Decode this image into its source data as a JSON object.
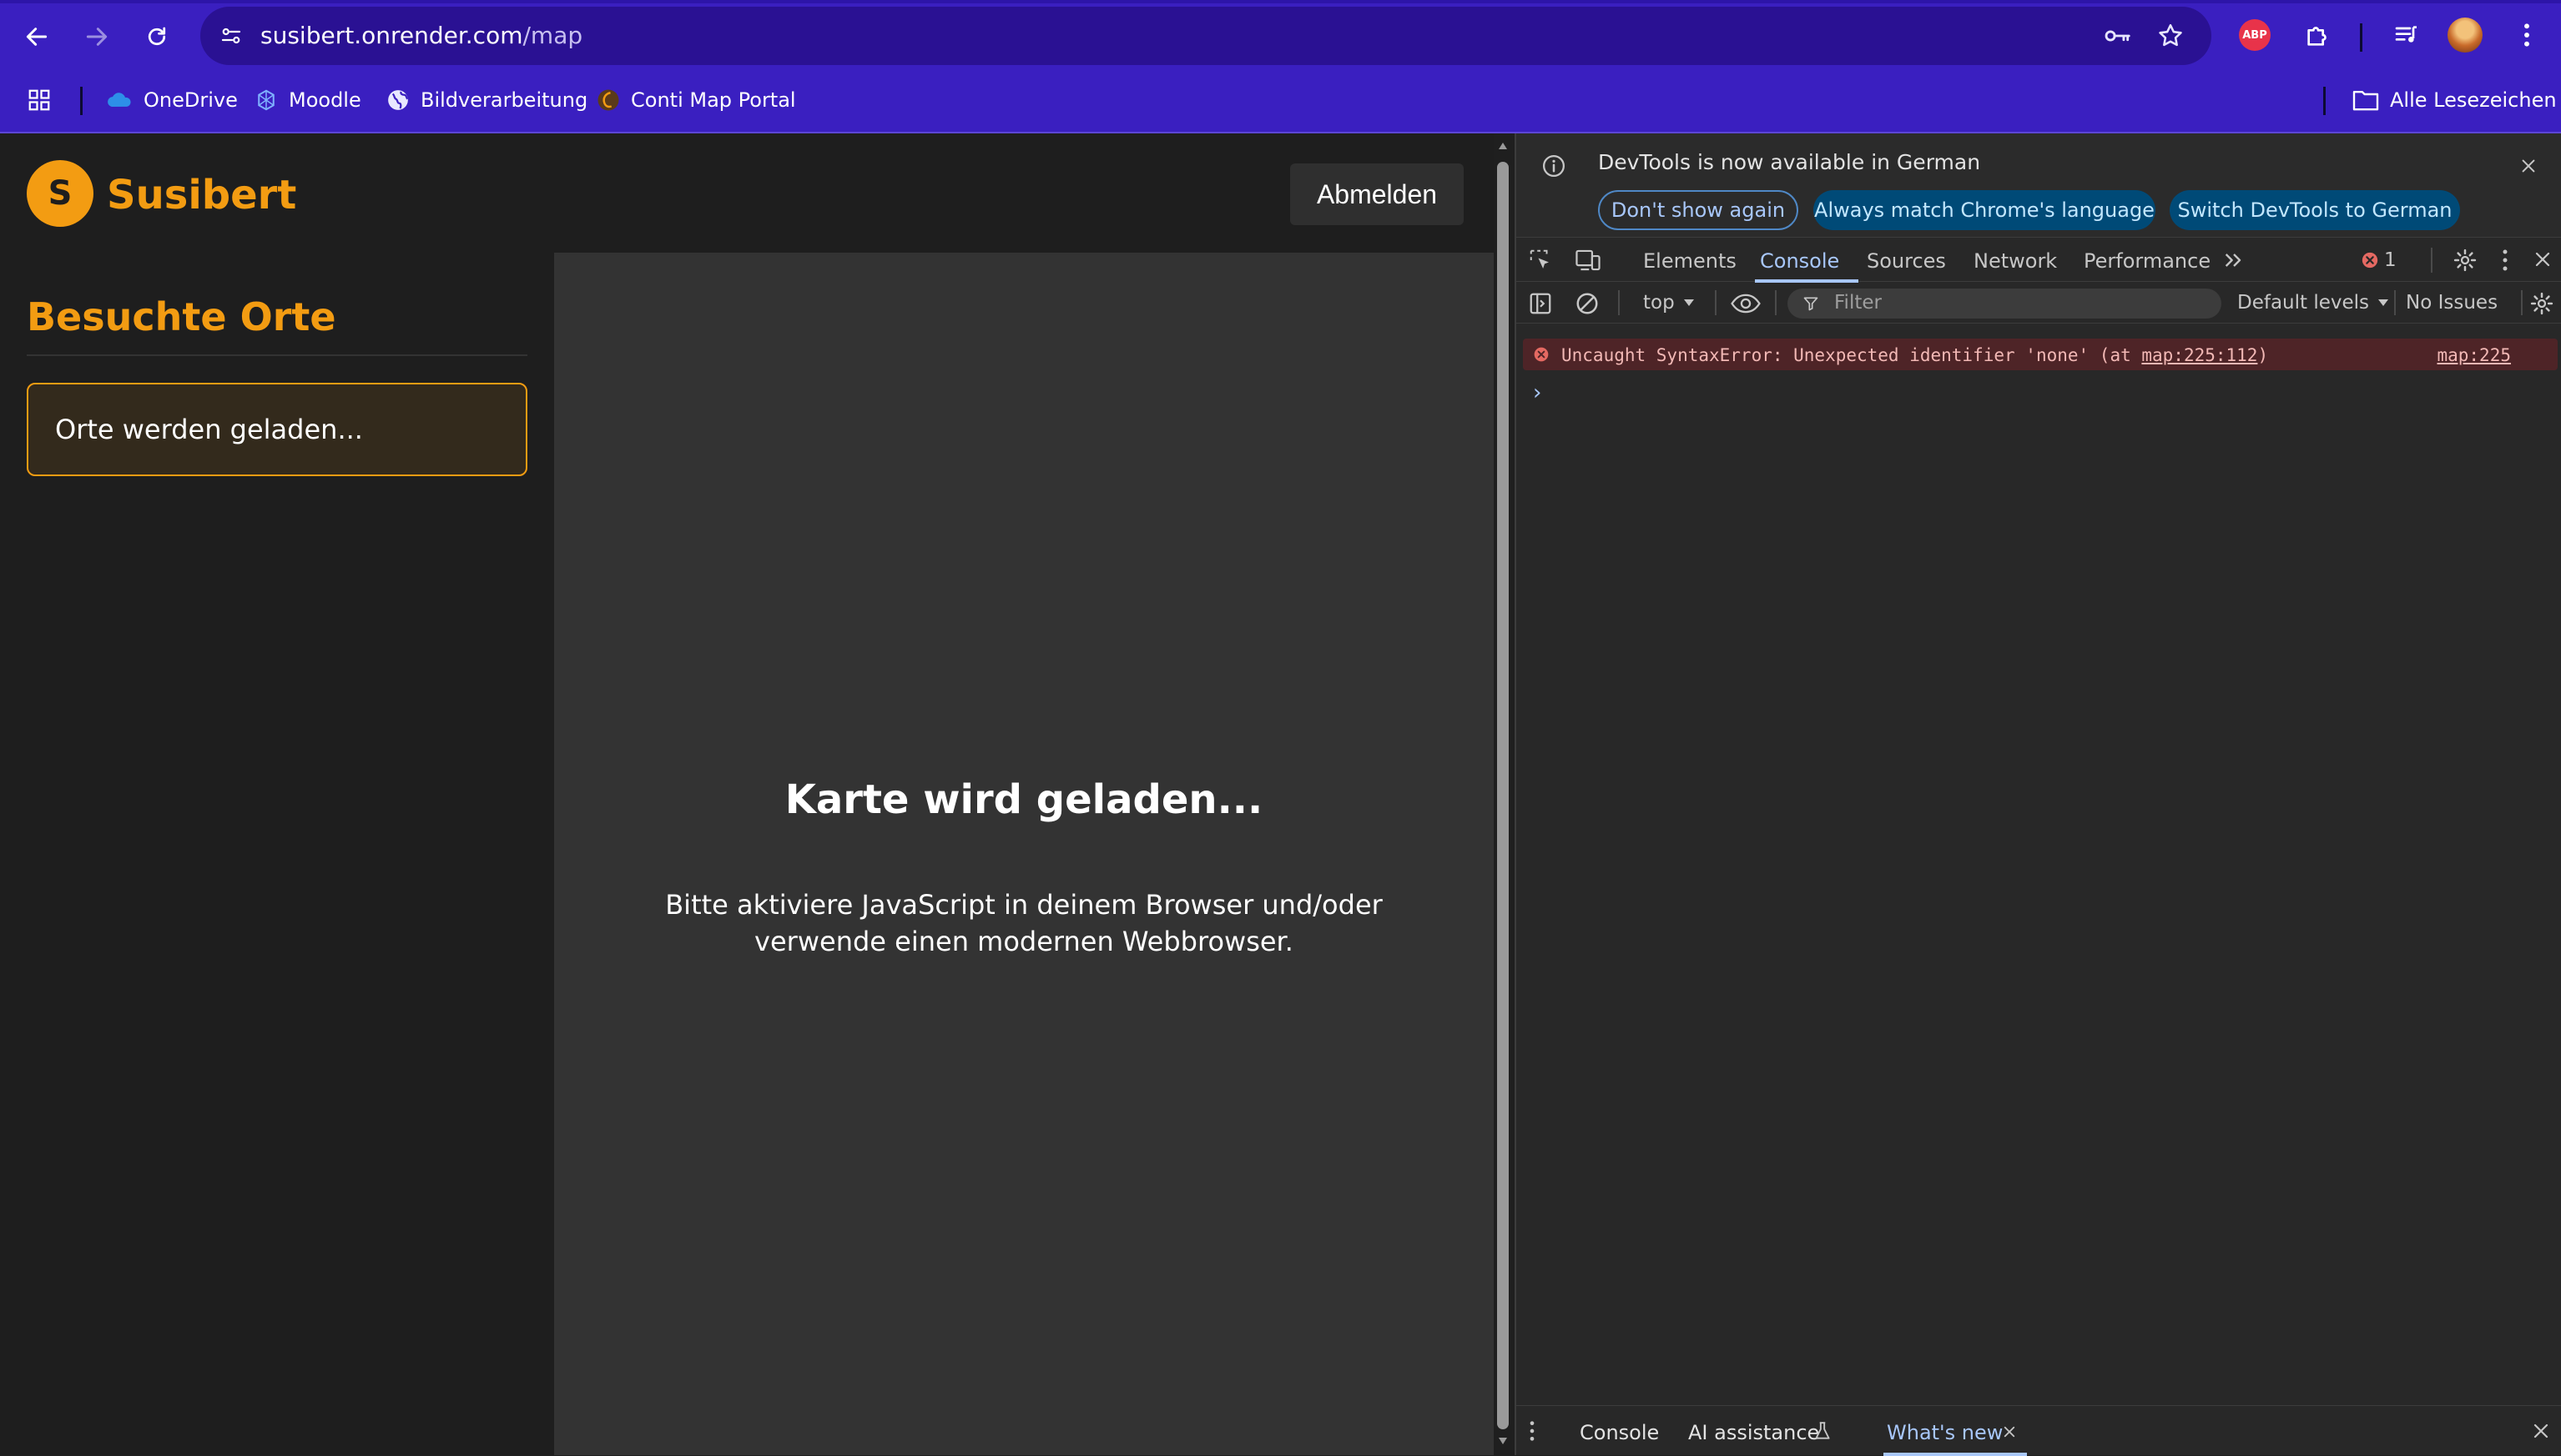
{
  "browser": {
    "url_host": "susibert.onrender.com",
    "url_path": "/map",
    "bookmarks": [
      {
        "label": "OneDrive",
        "icon": "onedrive-icon"
      },
      {
        "label": "Moodle",
        "icon": "moodle-icon"
      },
      {
        "label": "Bildverarbeitung",
        "icon": "globe-icon"
      },
      {
        "label": "Conti Map Portal",
        "icon": "conti-icon"
      }
    ],
    "all_bookmarks": "Alle Lesezeichen",
    "abp_badge": "ABP"
  },
  "page": {
    "logo_letter": "S",
    "brand": "Susibert",
    "logout_label": "Abmelden",
    "sidebar_title": "Besuchte Orte",
    "sidebar_loading": "Orte werden geladen...",
    "map_title": "Karte wird geladen...",
    "map_message": "Bitte aktiviere JavaScript in deinem Browser und/oder verwende einen modernen Webbrowser."
  },
  "devtools": {
    "banner_text": "DevTools is now available in German",
    "banner_buttons": {
      "dont_show": "Don't show again",
      "match_language": "Always match Chrome's language",
      "switch": "Switch DevTools to German"
    },
    "tabs": [
      "Elements",
      "Console",
      "Sources",
      "Network",
      "Performance"
    ],
    "active_tab": "Console",
    "error_count": "1",
    "context": "top",
    "filter_placeholder": "Filter",
    "levels": "Default levels",
    "issues": "No Issues",
    "error": {
      "prefix": "Uncaught SyntaxError: Unexpected identifier 'none' (at ",
      "link": "map:225:112",
      "suffix": ")",
      "source": "map:225"
    },
    "prompt": "›",
    "drawer_tabs": [
      "Console",
      "AI assistance",
      "What's new"
    ]
  },
  "colors": {
    "chrome_bg": "#3a1fc0",
    "accent": "#f39c12",
    "devtools_accent": "#a8c7fa",
    "error_bg": "#4e2427"
  }
}
